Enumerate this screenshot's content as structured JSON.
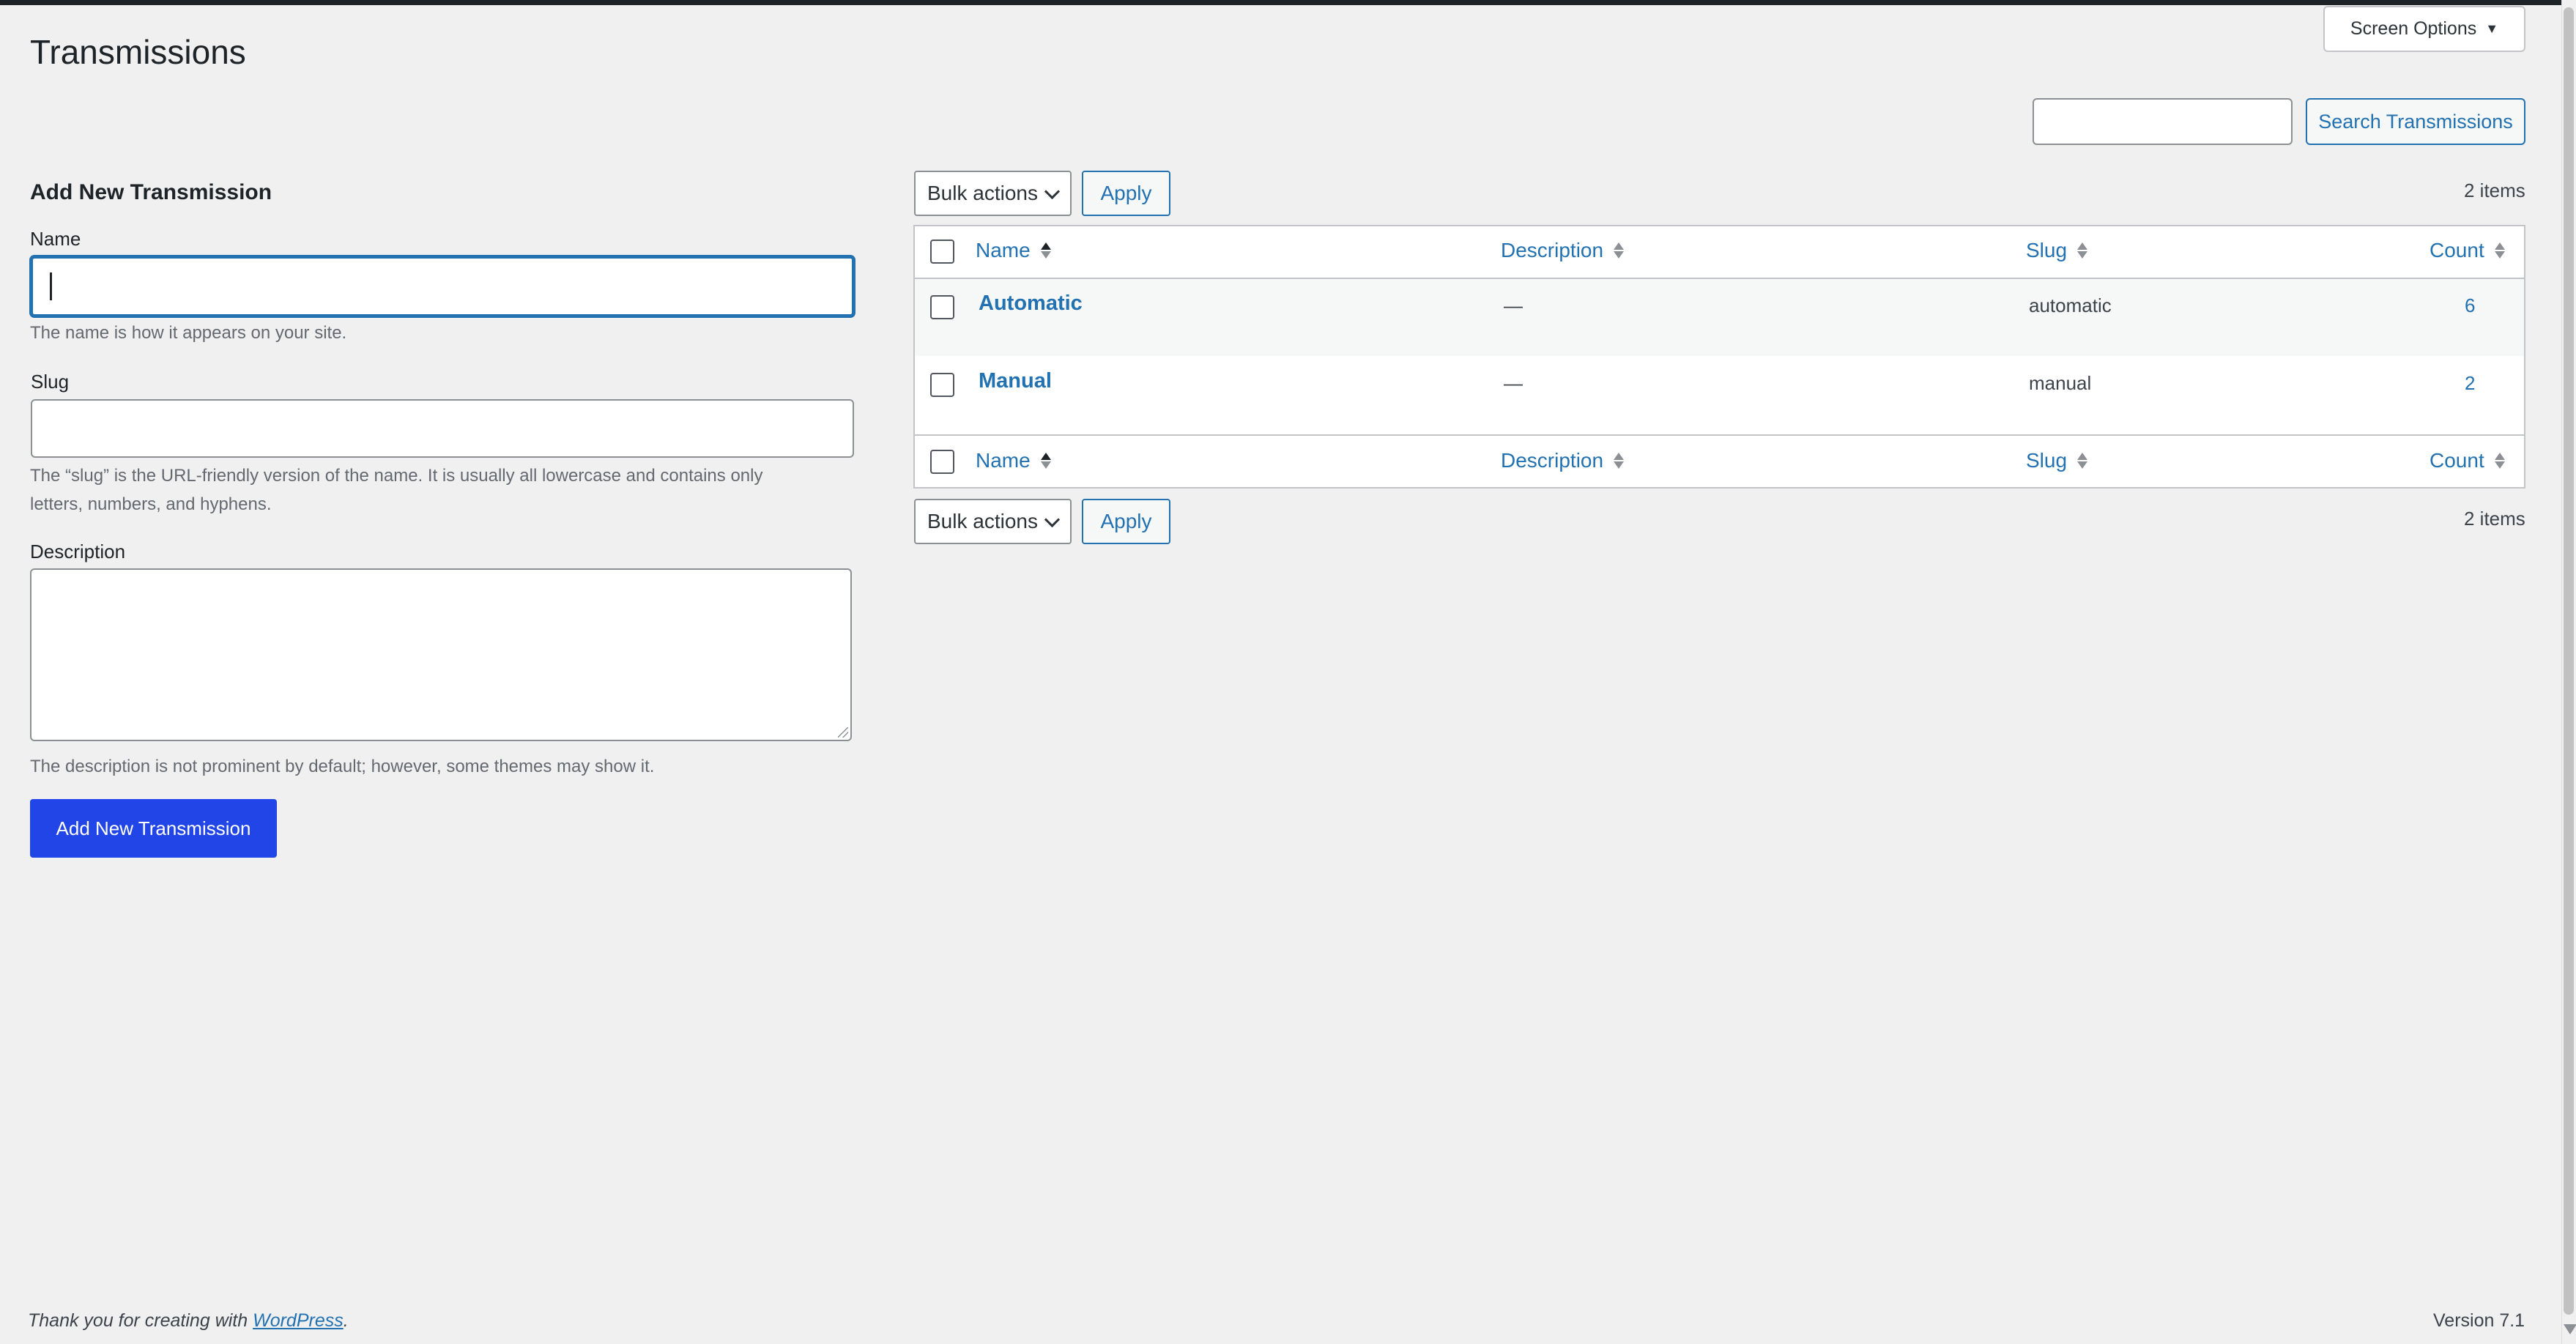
{
  "screen_options": {
    "label": "Screen Options",
    "icon": "triangle-down-icon"
  },
  "page": {
    "title": "Transmissions"
  },
  "search": {
    "value": "",
    "placeholder": "",
    "button_label": "Search Transmissions"
  },
  "form": {
    "heading": "Add New Transmission",
    "name": {
      "label": "Name",
      "value": "",
      "help": "The name is how it appears on your site."
    },
    "slug": {
      "label": "Slug",
      "value": "",
      "help_line1": "The “slug” is the URL-friendly version of the name. It is usually all lowercase and contains only",
      "help_line2": "letters, numbers, and hyphens."
    },
    "description": {
      "label": "Description",
      "value": "",
      "help": "The description is not prominent by default; however, some themes may show it."
    },
    "submit_label": "Add New Transmission"
  },
  "tablenav": {
    "bulk_label": "Bulk actions",
    "apply_label": "Apply",
    "items_count": "2 items"
  },
  "table": {
    "columns": {
      "name": "Name",
      "description": "Description",
      "slug": "Slug",
      "count": "Count"
    },
    "rows": [
      {
        "name": "Automatic",
        "description": "—",
        "slug": "automatic",
        "count": "6"
      },
      {
        "name": "Manual",
        "description": "—",
        "slug": "manual",
        "count": "2"
      }
    ]
  },
  "footer": {
    "thanks_prefix": "Thank you for creating with ",
    "thanks_link": "WordPress",
    "thanks_suffix": ".",
    "version": "Version 7.1"
  },
  "colors": {
    "accent": "#2271b1",
    "primary_button": "#2145e6",
    "background": "#f0f0f1",
    "adminbar": "#1d2327"
  }
}
